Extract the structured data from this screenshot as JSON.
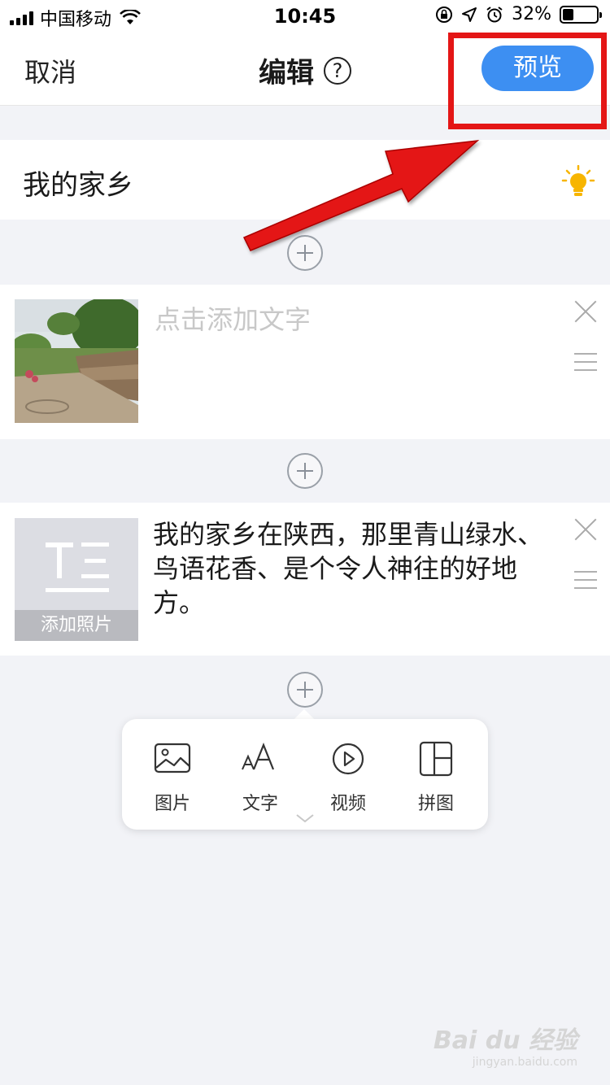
{
  "status_bar": {
    "carrier": "中国移动",
    "time": "10:45",
    "battery_percent": "32%",
    "battery_level": 0.32
  },
  "nav": {
    "cancel_label": "取消",
    "title": "编辑",
    "help_glyph": "?",
    "preview_label": "预览",
    "preview_color": "#3d8ff2"
  },
  "title_card": {
    "title": "我的家乡",
    "icon": "lightbulb-icon"
  },
  "blocks": [
    {
      "type": "photo",
      "placeholder": "点击添加文字",
      "icons": [
        "close-icon",
        "drag-handle-icon"
      ]
    },
    {
      "type": "text",
      "photo_placeholder_label": "添加照片",
      "text": "我的家乡在陕西，那里青山绿水、鸟语花香、是个令人神往的好地方。",
      "icons": [
        "close-icon",
        "drag-handle-icon"
      ]
    }
  ],
  "insert_menu": {
    "items": [
      {
        "label": "图片",
        "icon": "image-icon"
      },
      {
        "label": "文字",
        "icon": "text-icon"
      },
      {
        "label": "视频",
        "icon": "video-play-icon"
      },
      {
        "label": "拼图",
        "icon": "collage-icon"
      }
    ]
  },
  "annotation": {
    "color": "#e41616"
  },
  "watermark": {
    "main": "Bai du 经验",
    "sub": "jingyan.baidu.com"
  }
}
